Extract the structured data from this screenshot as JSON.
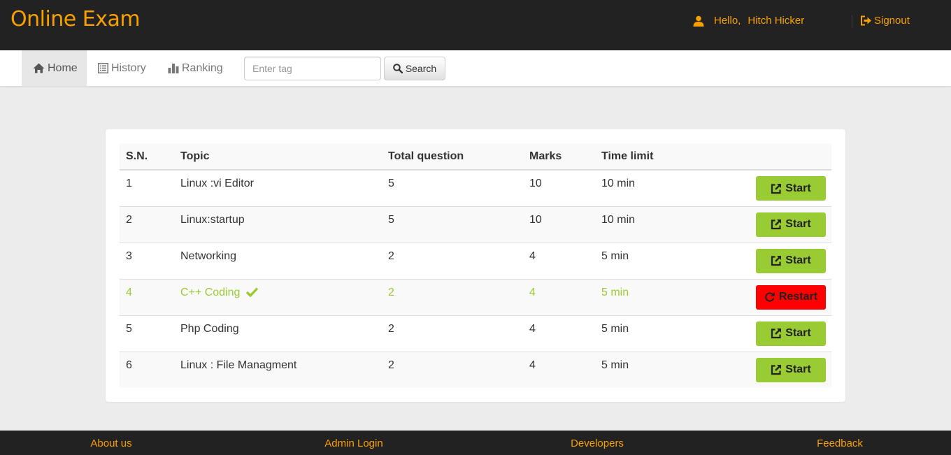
{
  "header": {
    "logo": "Online Exam",
    "greeting": "Hello,",
    "username": "Hitch Hicker",
    "signout": "Signout"
  },
  "nav": {
    "home": "Home",
    "history": "History",
    "ranking": "Ranking",
    "search_placeholder": "Enter tag",
    "search_button": "Search"
  },
  "table": {
    "columns": [
      "S.N.",
      "Topic",
      "Total question",
      "Marks",
      "Time limit"
    ],
    "rows": [
      {
        "sn": "1",
        "topic": "Linux :vi Editor",
        "total": "5",
        "marks": "10",
        "time": "10 min",
        "action": "Start",
        "completed": false
      },
      {
        "sn": "2",
        "topic": "Linux:startup",
        "total": "5",
        "marks": "10",
        "time": "10 min",
        "action": "Start",
        "completed": false
      },
      {
        "sn": "3",
        "topic": "Networking",
        "total": "2",
        "marks": "4",
        "time": "5 min",
        "action": "Start",
        "completed": false
      },
      {
        "sn": "4",
        "topic": "C++ Coding",
        "total": "2",
        "marks": "4",
        "time": "5 min",
        "action": "Restart",
        "completed": true
      },
      {
        "sn": "5",
        "topic": "Php Coding",
        "total": "2",
        "marks": "4",
        "time": "5 min",
        "action": "Start",
        "completed": false
      },
      {
        "sn": "6",
        "topic": "Linux : File Managment",
        "total": "2",
        "marks": "4",
        "time": "5 min",
        "action": "Start",
        "completed": false
      }
    ]
  },
  "footer": {
    "links": [
      "About us",
      "Admin Login",
      "Developers",
      "Feedback"
    ]
  },
  "colors": {
    "accent": "#f8a000",
    "start": "#99cc33",
    "restart": "#ff0000",
    "header_bg": "#222222"
  },
  "icons": {
    "user": "user-icon",
    "signout": "signout-icon",
    "home": "home-icon",
    "history": "list-icon",
    "ranking": "bar-chart-icon",
    "search": "search-icon",
    "start": "external-link-icon",
    "restart": "refresh-icon",
    "completed": "check-icon"
  }
}
